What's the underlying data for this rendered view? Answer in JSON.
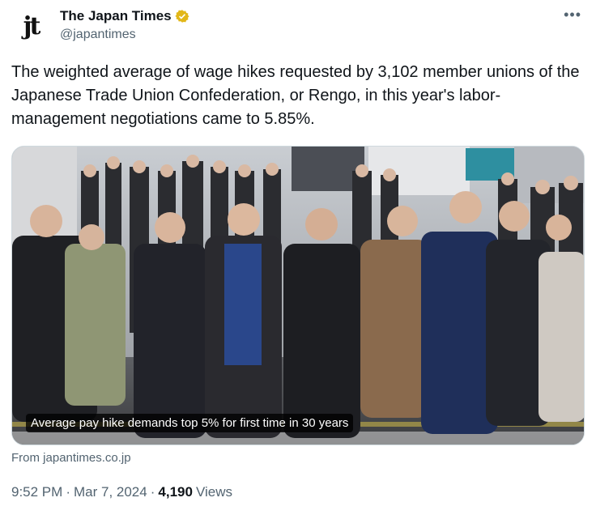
{
  "author": {
    "display_name": "The Japan Times",
    "handle": "@japantimes",
    "avatar_text": "jt",
    "verified_color": "#e2b719"
  },
  "tweet": {
    "text": "The weighted average of wage hikes requested by 3,102 member unions of the Japanese Trade Union Confederation, or Rengo, in this year's labor-management negotiations came to 5.85%."
  },
  "card": {
    "image_alt": "crowd-of-commuters-crossing-street-photo",
    "caption": "Average pay hike demands top 5% for first time in 30 years",
    "source_prefix": "From",
    "source_domain": "japantimes.co.jp"
  },
  "meta": {
    "time": "9:52 PM",
    "date": "Mar 7, 2024",
    "views_count": "4,190",
    "views_label": "Views",
    "separator": "·"
  },
  "icons": {
    "more": "more-horizontal-icon",
    "verified": "verified-badge-icon"
  },
  "colors": {
    "text_primary": "#0f1419",
    "text_secondary": "#536471",
    "border": "#cfd9de"
  }
}
